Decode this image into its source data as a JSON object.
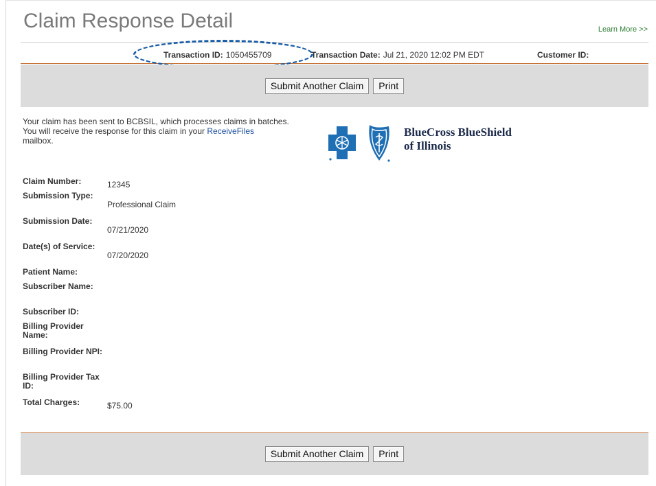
{
  "page": {
    "title": "Claim Response Detail",
    "learn_more": "Learn More >>"
  },
  "info": {
    "transaction_id_label": "Transaction ID:",
    "transaction_id": "1050455709",
    "transaction_date_label": "Transaction Date:",
    "transaction_date": "Jul 21, 2020 12:02 PM EDT",
    "customer_id_label": "Customer ID:",
    "customer_id": ""
  },
  "buttons": {
    "submit_another": "Submit Another Claim",
    "print": "Print"
  },
  "message": {
    "line1_pre": "Your claim has been sent to",
    "payer": "BCBSIL,",
    "line1_post": " which processes claims in batches.",
    "line2_pre": "You will receive the response for this claim in your ",
    "link": "ReceiveFiles",
    "line2_post": "mailbox."
  },
  "logo": {
    "line1": "BlueCross BlueShield",
    "line2": "of Illinois",
    "brand_color": "#1f6fb4"
  },
  "details": [
    {
      "label": "Claim Number:",
      "value": "12345"
    },
    {
      "label": "Submission Type:",
      "value": "Professional Claim"
    },
    {
      "label": "Submission Date:",
      "value": "07/21/2020"
    },
    {
      "label": "Date(s) of Service:",
      "value": "07/20/2020"
    },
    {
      "label": "Patient Name:",
      "value": ""
    },
    {
      "label": "Subscriber Name:",
      "value": ""
    },
    {
      "label": "Subscriber ID:",
      "value": ""
    },
    {
      "label": "Billing Provider Name:",
      "value": ""
    },
    {
      "label": "Billing Provider NPI:",
      "value": ""
    },
    {
      "label": "Billing Provider Tax ID:",
      "value": ""
    },
    {
      "label": "Total Charges:",
      "value": "$75.00"
    }
  ]
}
